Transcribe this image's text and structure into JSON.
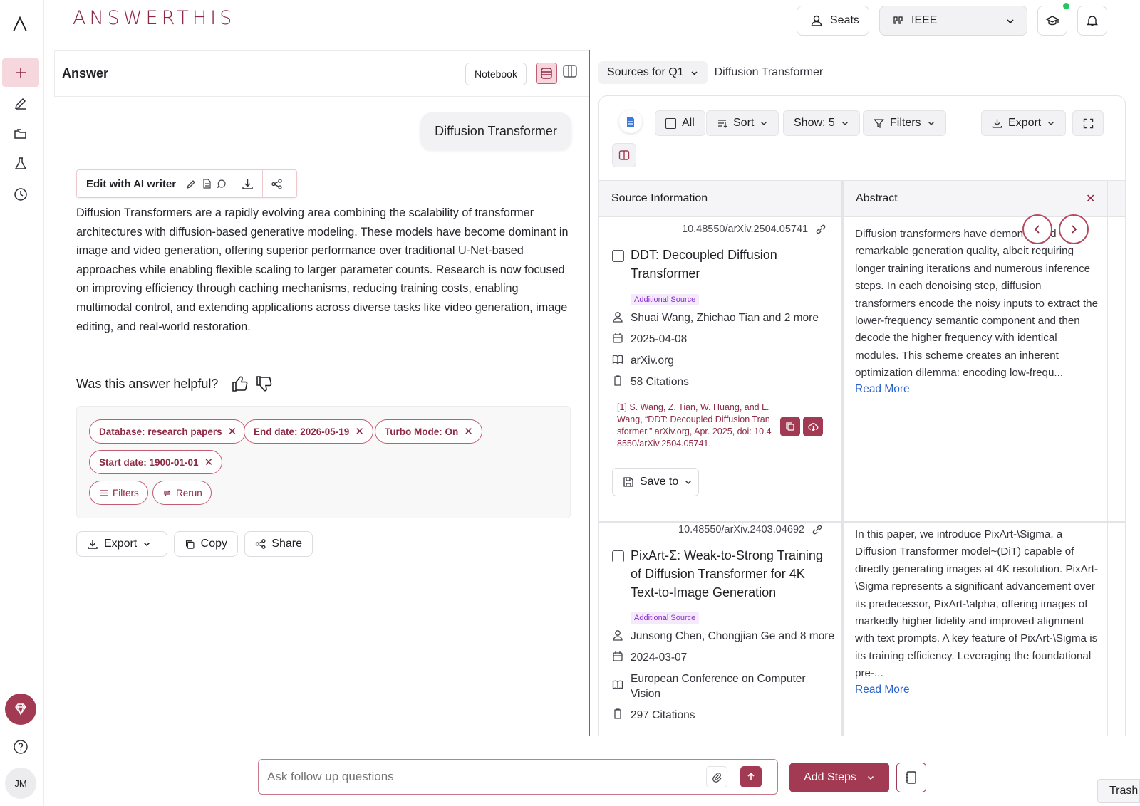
{
  "app": {
    "logo": "ANSWERTHIS",
    "brand_color": "#8e2944",
    "accent": "#b8485f"
  },
  "header": {
    "seats_label": "Seats",
    "citation_style": "IEEE"
  },
  "user": {
    "initials": "JM"
  },
  "answer": {
    "pane_title": "Answer",
    "notebook_label": "Notebook",
    "query": "Diffusion Transformer",
    "edit_label": "Edit with AI writer",
    "text": "Diffusion Transformers are a rapidly evolving area combining the scalability of transformer architectures with diffusion-based generative modeling. These models have become dominant in image and video generation, offering superior performance over traditional U-Net-based approaches while enabling flexible scaling to larger parameter counts. Research is now focused on improving efficiency through caching mechanisms, reducing training costs, enabling multimodal control, and extending applications across diverse tasks like video generation, image editing, and real-world restoration.",
    "helpful_prompt": "Was this answer helpful?",
    "chips": [
      "Database: research papers",
      "End date: 2026-05-19",
      "Turbo Mode: On",
      "Start date: 1900-01-01"
    ],
    "filters_label": "Filters",
    "rerun_label": "Rerun",
    "export_label": "Export",
    "copy_label": "Copy",
    "share_label": "Share"
  },
  "sources": {
    "select_label": "Sources for Q1",
    "query_label": "Diffusion Transformer",
    "all_label": "All",
    "sort_label": "Sort",
    "show_label": "Show: 5",
    "filters_label": "Filters",
    "export_label": "Export",
    "col_source": "Source Information",
    "col_abstract": "Abstract",
    "items": [
      {
        "doi": "10.48550/arXiv.2504.05741",
        "title": "DDT: Decoupled Diffusion Transformer",
        "badge": "Additional Source",
        "authors": "Shuai Wang, Zhichao Tian and 2 more",
        "date": "2025-04-08",
        "venue": "arXiv.org",
        "citations": "58 Citations",
        "citation_text": "[1] S. Wang, Z. Tian, W. Huang, and L. Wang, “DDT: Decoupled Diffusion Transformer,” arXiv.org, Apr. 2025, doi: 10.48550/arXiv.2504.05741.",
        "save_label": "Save to",
        "abstract": "Diffusion transformers have demonstrated remarkable generation quality, albeit requiring longer training iterations and numerous inference steps. In each denoising step, diffusion transformers encode the noisy inputs to extract the lower-frequency semantic component and then decode the higher frequency with identical modules. This scheme creates an inherent optimization dilemma: encoding low-frequ...",
        "read_more": "Read More"
      },
      {
        "doi": "10.48550/arXiv.2403.04692",
        "title": "PixArt-Σ: Weak-to-Strong Training of Diffusion Transformer for 4K Text-to-Image Generation",
        "badge": "Additional Source",
        "authors": "Junsong Chen, Chongjian Ge and 8 more",
        "date": "2024-03-07",
        "venue": "European Conference on Computer Vision",
        "citations": "297 Citations",
        "abstract": "In this paper, we introduce PixArt-\\Sigma, a Diffusion Transformer model~(DiT) capable of directly generating images at 4K resolution. PixArt-\\Sigma represents a significant advancement over its predecessor, PixArt-\\alpha, offering images of markedly higher fidelity and improved alignment with text prompts. A key feature of PixArt-\\Sigma is its training efficiency. Leveraging the foundational pre-...",
        "read_more": "Read More"
      }
    ]
  },
  "composer": {
    "placeholder": "Ask follow up questions",
    "add_steps_label": "Add Steps"
  },
  "tooltip": {
    "trash_label": "Trash"
  }
}
